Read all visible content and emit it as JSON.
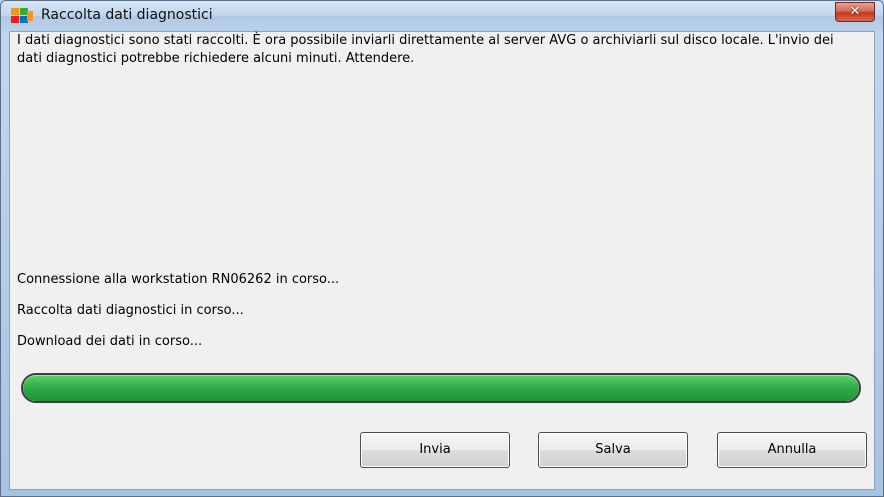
{
  "window": {
    "title": "Raccolta dati diagnostici",
    "close_glyph": "✕"
  },
  "content": {
    "intro": "I dati diagnostici sono stati raccolti. È ora possibile inviarli direttamente al server AVG o archiviarli sul disco locale. L'invio dei dati diagnostici potrebbe richiedere alcuni minuti. Attendere.",
    "status_lines": [
      "Connessione alla workstation RN06262 in corso...",
      "Raccolta dati diagnostici in corso...",
      "Download dei dati in corso..."
    ],
    "progress_fraction": 1.0
  },
  "buttons": {
    "send": "Invia",
    "save": "Salva",
    "cancel": "Annulla"
  },
  "colors": {
    "progress_green": "#2eae47",
    "close_red": "#c0391f",
    "icon_orange": "#f7941d",
    "icon_green": "#3aaa35",
    "icon_blue": "#0072bc",
    "icon_red": "#ed1c24"
  }
}
